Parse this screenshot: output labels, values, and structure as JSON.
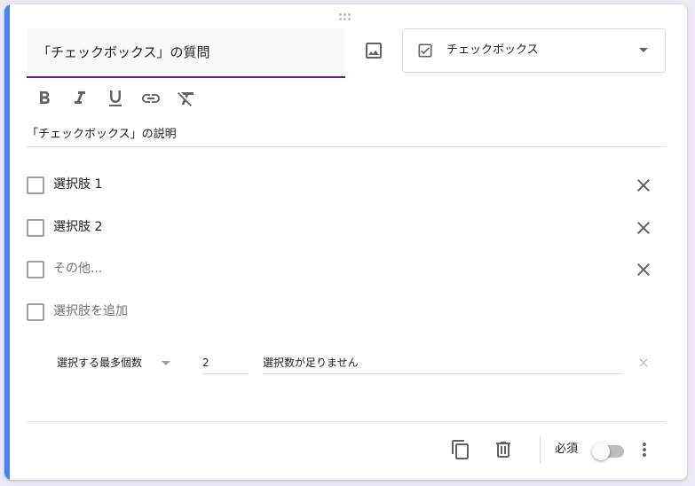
{
  "question": {
    "title": "「チェックボックス」の質問",
    "description": "「チェックボックス」の説明"
  },
  "type_select": {
    "label": "チェックボックス",
    "icon": "checkbox-icon"
  },
  "format_toolbar": [
    "bold-icon",
    "italic-icon",
    "underline-icon",
    "link-icon",
    "clear-format-icon"
  ],
  "options": [
    {
      "label": "選択肢 1"
    },
    {
      "label": "選択肢 2"
    },
    {
      "label": "その他..."
    }
  ],
  "add_option_label": "選択肢を追加",
  "validation": {
    "type": "選択する最多個数",
    "number": "2",
    "error_text": "選択数が足りません"
  },
  "footer": {
    "required_label": "必須",
    "required": false
  },
  "colors": {
    "accent": "#4285f4",
    "title_underline": "#6a1b9a",
    "background": "#ede7f6"
  }
}
